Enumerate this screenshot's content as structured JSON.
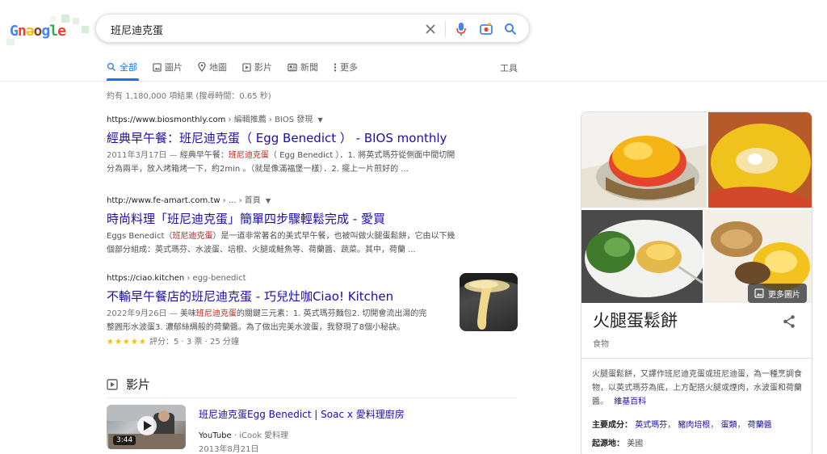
{
  "logo": {
    "text": "Google"
  },
  "search": {
    "query": "班尼迪克蛋"
  },
  "tabs": [
    {
      "label": "全部",
      "icon": "search-icon"
    },
    {
      "label": "圖片",
      "icon": "image-icon"
    },
    {
      "label": "地圖",
      "icon": "map-pin-icon"
    },
    {
      "label": "影片",
      "icon": "play-icon"
    },
    {
      "label": "新聞",
      "icon": "news-icon"
    },
    {
      "label": "更多",
      "icon": "more-vertical-icon"
    }
  ],
  "tools_label": "工具",
  "stats": "約有 1,180,000 項結果 (搜尋時間：0.65 秒)",
  "results": [
    {
      "cite_url": "https://www.biosmonthly.com",
      "cite_path": " › 編輯推薦 › BIOS 發現",
      "title": "經典早午餐：班尼迪克蛋（ Egg Benedict ） - BIOS monthly",
      "date": "2011年3月17日 — ",
      "line1_pre": "經典早午餐：",
      "line1_hl": "班尼迪克蛋",
      "line1_post": "（ Egg Benedict ）．1. 將英式瑪芬從側面中間切開",
      "line2": "分為兩半，放入烤箱烤一下，約2min 。（就是像滿福堡一樣）．2. 擺上一片煎好的 ..."
    },
    {
      "cite_url": "http://www.fe-amart.com.tw",
      "cite_path": " › ... › 首頁",
      "title": "時尚料理「班尼迪克蛋」簡單四步驟輕鬆完成 - 愛買",
      "line1_pre": "Eggs Benedict（",
      "line1_hl": "班尼迪克蛋",
      "line1_post": "）是一道非常著名的美式早午餐，也被叫做火腿蛋鬆餅，它由以下幾",
      "line2": "個部分組成：英式瑪芬、水波蛋、培根、火腿或鮭魚等、荷蘭醬、蔬菜。其中，荷蘭 ..."
    },
    {
      "cite_url": "https://ciao.kitchen",
      "cite_path": " › egg-benedict",
      "title": "不輸早午餐店的班尼迪克蛋 - 巧兒灶咖Ciao! Kitchen",
      "date": "2022年9月26日 — ",
      "line1_pre": "美味",
      "line1_hl": "班尼迪克蛋",
      "line1_post": "的關鍵三元素：1. 英式瑪芬麵包2. 切開會流出湯的完",
      "line2": "整圓形水波蛋3. 濃郁絲綢般的荷蘭醬。為了做出完美水波蛋，我發現了8個小秘訣。",
      "stars": "★★★★★",
      "rating": " 評分：5 · 3 票 · 25 分鐘"
    }
  ],
  "videos": {
    "heading": "影片",
    "items": [
      {
        "title": "班尼迪克蛋Egg Benedict | Soac x 愛料理廚房",
        "source": "YouTube",
        "channel": " · iCook 愛料理",
        "date": "2013年8月21日",
        "duration": "3:44"
      }
    ]
  },
  "knowledge_panel": {
    "more_images": "更多圖片",
    "title": "火腿蛋鬆餅",
    "subtitle": "食物",
    "description": "火腿蛋鬆餅，又譯作班尼迪克蛋或班尼迪蛋，為一種烹調食物，以英式瑪芬為底，上方配搭火腿或煙肉，水波蛋和荷蘭醬。",
    "source_link": "維基百科",
    "ingredients_label": "主要成分：",
    "ingredients": [
      "英式瑪芬",
      "豬肉培根",
      "蛋類",
      "荷蘭醬"
    ],
    "origin_label": "起源地：",
    "origin": "美國"
  },
  "colors": {
    "link": "#1a0dab",
    "accent": "#1a73e8",
    "highlight": "#c5221f",
    "star": "#fbbc04"
  }
}
